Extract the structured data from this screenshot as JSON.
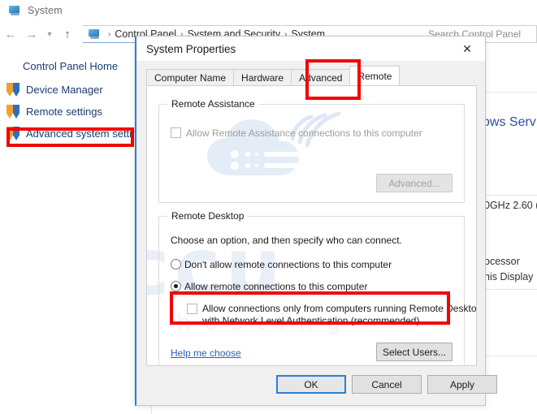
{
  "background_window": {
    "title": "System",
    "title_icon": "system-monitor-icon",
    "nav": {
      "back_icon": "arrow-left-icon",
      "forward_icon": "arrow-right-icon",
      "history_icon": "chevron-down-icon",
      "up_icon": "arrow-up-icon"
    },
    "breadcrumb": {
      "icon": "system-monitor-icon",
      "items": [
        "Control Panel",
        "System and Security",
        "System"
      ],
      "separator": "›"
    },
    "search": {
      "placeholder": "Search Control Panel",
      "visible_text": "Search Control"
    },
    "sidebar": {
      "home_label": "Control Panel Home",
      "items": [
        {
          "label": "Device Manager",
          "icon": "shield-icon"
        },
        {
          "label": "Remote settings",
          "icon": "shield-icon"
        },
        {
          "label": "Advanced system settings",
          "icon": "shield-icon",
          "highlighted": true
        }
      ]
    },
    "content_fragments": [
      {
        "text": "ows Serv",
        "style": "blue"
      },
      {
        "text": "0GHz  2.60 (",
        "style": "plain"
      },
      {
        "text": "ocessor",
        "style": "plain"
      },
      {
        "text": "his Display",
        "style": "plain"
      }
    ]
  },
  "watermark": {
    "brand": "accu",
    "tagline": "web hosting",
    "cloud_icon": "cloud-server-icon",
    "color": "#e8eff8"
  },
  "dialog": {
    "title": "System Properties",
    "close_icon": "close-icon",
    "tabs": [
      {
        "label": "Computer Name",
        "active": false
      },
      {
        "label": "Hardware",
        "active": false
      },
      {
        "label": "Advanced",
        "active": false
      },
      {
        "label": "Remote",
        "active": true,
        "highlighted": true
      }
    ],
    "remote_assistance": {
      "group_title": "Remote Assistance",
      "checkbox_label": "Allow Remote Assistance connections to this computer",
      "checkbox_checked": false,
      "checkbox_disabled": true,
      "advanced_button": "Advanced...",
      "advanced_disabled": true
    },
    "remote_desktop": {
      "group_title": "Remote Desktop",
      "instruction": "Choose an option, and then specify who can connect.",
      "options": [
        {
          "label": "Don't allow remote connections to this computer",
          "selected": false
        },
        {
          "label": "Allow remote connections to this computer",
          "selected": true
        }
      ],
      "nla_checkbox": {
        "line1": "Allow connections only from computers running Remote Desktop",
        "line2": "with Network Level Authentication (recommended)",
        "checked": false,
        "highlighted": true
      },
      "help_link": "Help me choose",
      "select_users_button": "Select Users..."
    },
    "footer_buttons": [
      {
        "label": "OK",
        "default": true
      },
      {
        "label": "Cancel",
        "default": false
      },
      {
        "label": "Apply",
        "default": false
      }
    ]
  },
  "annotations": {
    "highlight_color": "#f40000",
    "boxes": [
      "advanced-system-settings",
      "remote-tab",
      "nla-checkbox"
    ]
  }
}
